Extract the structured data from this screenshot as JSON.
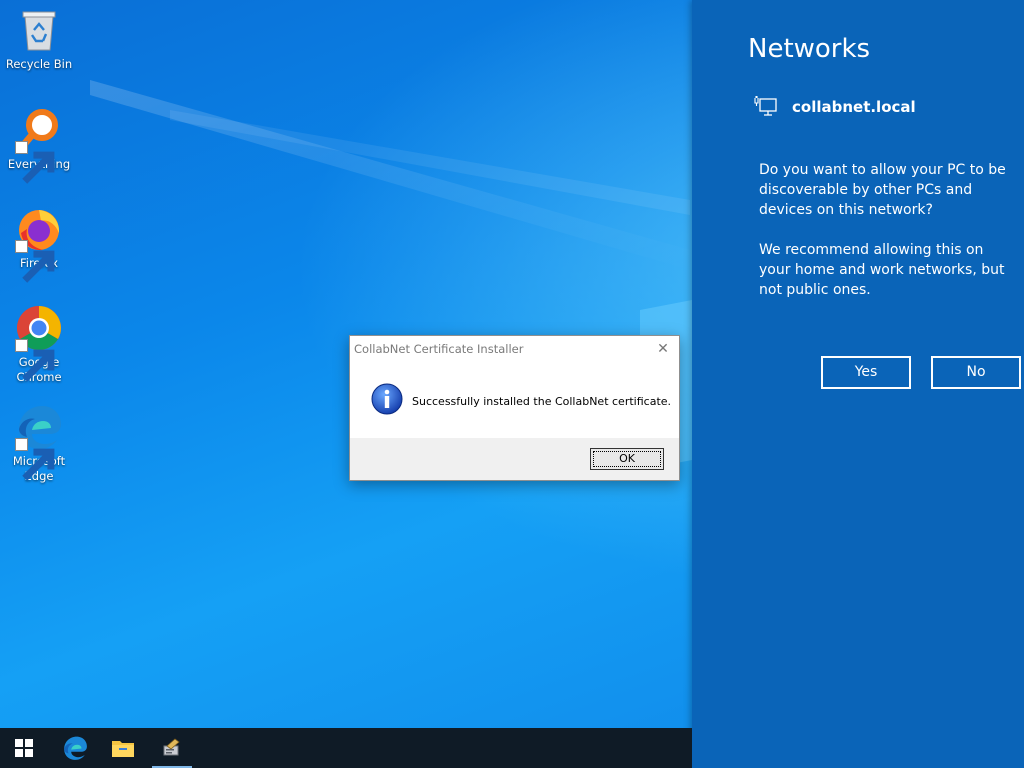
{
  "desktop": {
    "icons": [
      {
        "label": "Recycle Bin",
        "icon": "recycle-bin-icon"
      },
      {
        "label": "Everything",
        "icon": "everything-search-icon"
      },
      {
        "label": "Firefox",
        "icon": "firefox-icon"
      },
      {
        "label": "Google Chrome",
        "icon": "chrome-icon"
      },
      {
        "label": "Microsoft Edge",
        "icon": "edge-icon"
      }
    ]
  },
  "network_panel": {
    "title": "Networks",
    "network_name": "collabnet.local",
    "question": "Do you want to allow your PC to be discoverable by other PCs and devices on this network?",
    "recommendation": "We recommend allowing this on your home and work networks, but not public ones.",
    "yes_label": "Yes",
    "no_label": "No",
    "background": "#0a64b8"
  },
  "dialog": {
    "title": "CollabNet Certificate Installer",
    "close_glyph": "✕",
    "message": "Successfully installed the CollabNet certificate.",
    "ok_label": "OK",
    "icon": "info-icon"
  },
  "taskbar": {
    "items": [
      {
        "icon": "windows-start-icon"
      },
      {
        "icon": "edge-icon"
      },
      {
        "icon": "file-explorer-icon"
      },
      {
        "icon": "certificate-installer-icon",
        "active": true
      }
    ],
    "background": "#0f1b26"
  }
}
